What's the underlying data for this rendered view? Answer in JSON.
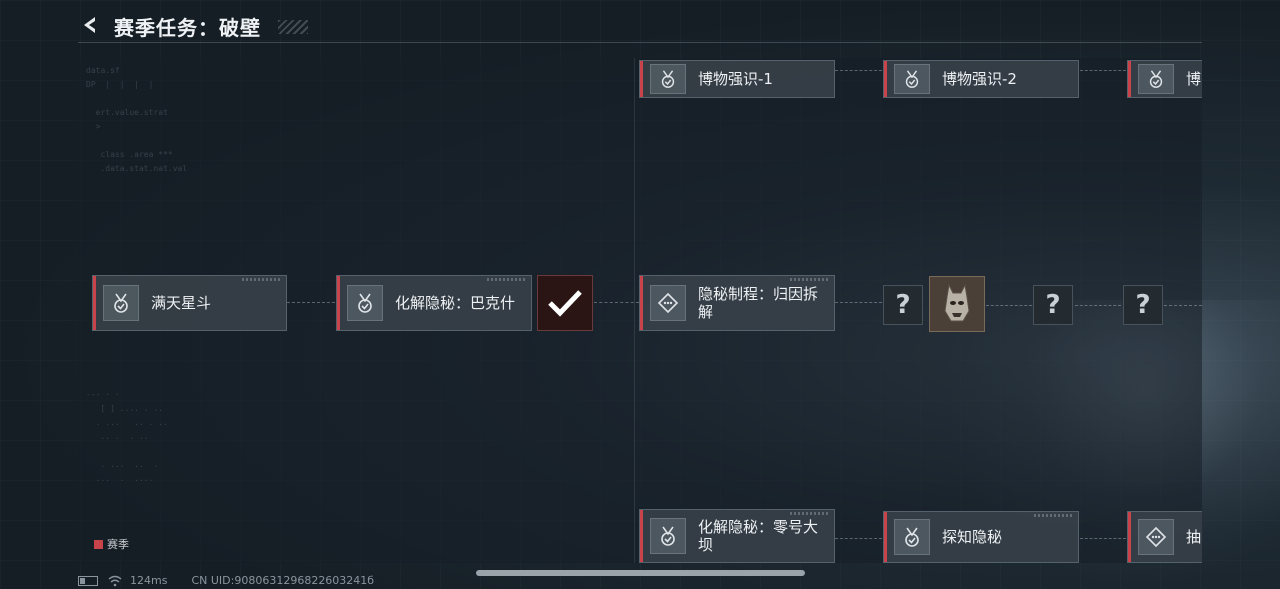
{
  "header": {
    "title": "赛季任务：破壁"
  },
  "colors": {
    "accent": "#c8444a",
    "panel": "#3a424a"
  },
  "nodes": {
    "n1": {
      "label": "满天星斗",
      "icon": "medal-check-icon"
    },
    "n2": {
      "label": "化解隐秘：巴克什",
      "icon": "medal-check-icon"
    },
    "n3": {
      "label": "博物强识-1",
      "icon": "medal-check-icon"
    },
    "n4": {
      "label": "博物强识-2",
      "icon": "medal-check-icon"
    },
    "n5": {
      "label": "博",
      "icon": "medal-check-icon"
    },
    "n6": {
      "label": "隐秘制程：归因拆解",
      "icon": "diamond-icon"
    },
    "n7": {
      "label": "化解隐秘：零号大坝",
      "icon": "medal-check-icon"
    },
    "n8": {
      "label": "探知隐秘",
      "icon": "medal-check-icon"
    },
    "n9": {
      "label": "抽",
      "icon": "diamond-icon"
    }
  },
  "unknown_mark": "?",
  "legend": {
    "label": "赛季"
  },
  "status": {
    "ping": "124ms",
    "uid": "CN UID:9080631296822603241б"
  }
}
